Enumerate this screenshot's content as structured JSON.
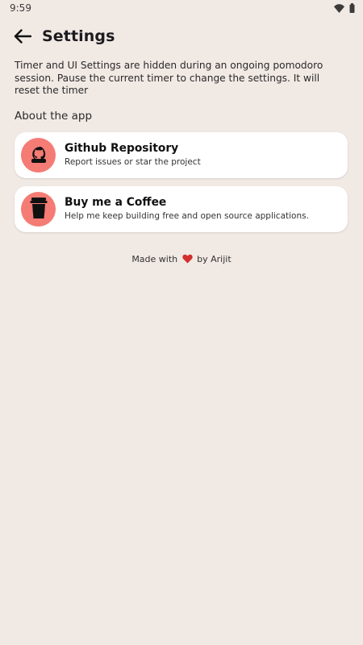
{
  "status_bar": {
    "time": "9:59"
  },
  "header": {
    "title": "Settings"
  },
  "info_text": "Timer and UI Settings are hidden during an ongoing pomodoro session. Pause the current timer to change the settings. It will reset the timer",
  "section": {
    "title": "About the app"
  },
  "cards": [
    {
      "title": "Github Repository",
      "subtitle": "Report issues or star the project",
      "icon": "github-icon"
    },
    {
      "title": "Buy me a Coffee",
      "subtitle": "Help me keep building free and open source applications.",
      "icon": "coffee-icon"
    }
  ],
  "footer": {
    "prefix": "Made with",
    "suffix": "by Arijit",
    "icon": "heart-icon"
  },
  "colors": {
    "background": "#f1e9e4",
    "card": "#ffffff",
    "icon_circle": "#f47c75",
    "heart": "#d32f2f"
  }
}
